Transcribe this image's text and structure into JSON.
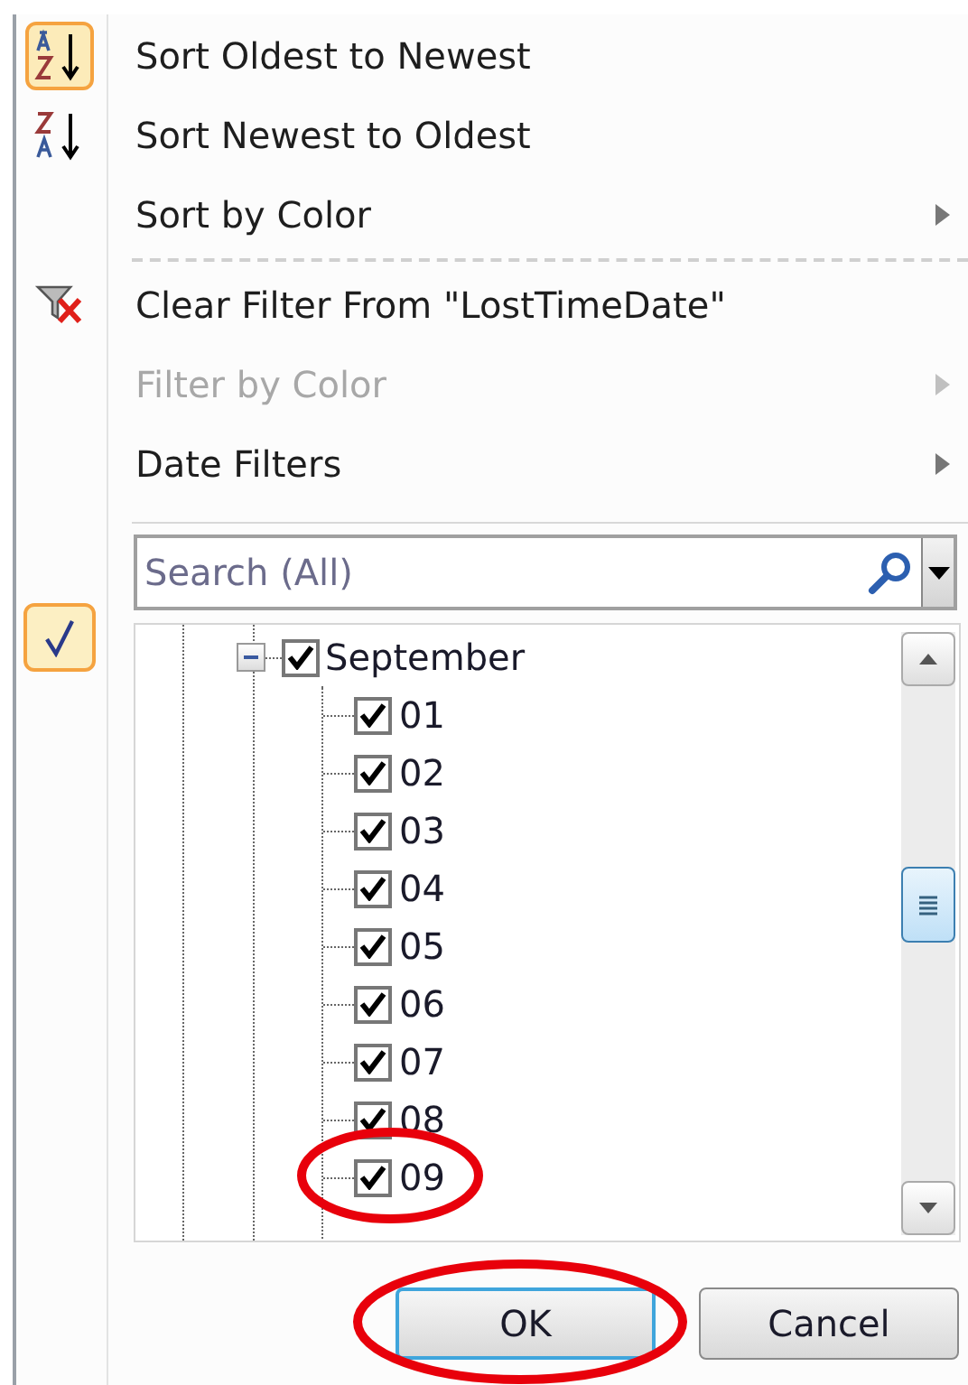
{
  "menu": {
    "items": [
      {
        "kind": "item",
        "label": "Sort Oldest to Newest",
        "checked": true,
        "disabled": false,
        "submenu": false
      },
      {
        "kind": "item",
        "label": "Sort Newest to Oldest",
        "checked": false,
        "disabled": false,
        "submenu": false
      },
      {
        "kind": "item",
        "label": "Sort by Color",
        "checked": false,
        "disabled": false,
        "submenu": true
      },
      {
        "kind": "separator"
      },
      {
        "kind": "item",
        "label": "Clear Filter From \"LostTimeDate\"",
        "checked": false,
        "disabled": false,
        "submenu": false
      },
      {
        "kind": "item",
        "label": "Filter by Color",
        "checked": false,
        "disabled": true,
        "submenu": true
      },
      {
        "kind": "item",
        "label": "Date Filters",
        "checked": false,
        "disabled": false,
        "submenu": true
      },
      {
        "kind": "separator"
      }
    ]
  },
  "filter_list_checked": true,
  "search": {
    "placeholder": "Search (All)"
  },
  "tree": [
    {
      "label": "September",
      "checked": true,
      "expanded": true,
      "highlighted": false,
      "children": [
        {
          "label": "01",
          "checked": true,
          "highlighted": false
        },
        {
          "label": "02",
          "checked": true,
          "highlighted": false
        },
        {
          "label": "03",
          "checked": true,
          "highlighted": false
        },
        {
          "label": "04",
          "checked": true,
          "highlighted": false
        },
        {
          "label": "05",
          "checked": true,
          "highlighted": false
        },
        {
          "label": "06",
          "checked": true,
          "highlighted": false
        },
        {
          "label": "07",
          "checked": true,
          "highlighted": false
        },
        {
          "label": "08",
          "checked": true,
          "highlighted": false
        },
        {
          "label": "09",
          "checked": true,
          "highlighted": true
        }
      ]
    }
  ],
  "buttons": [
    {
      "label": "OK",
      "default": true,
      "highlighted": true
    },
    {
      "label": "Cancel",
      "default": false,
      "highlighted": false
    }
  ]
}
